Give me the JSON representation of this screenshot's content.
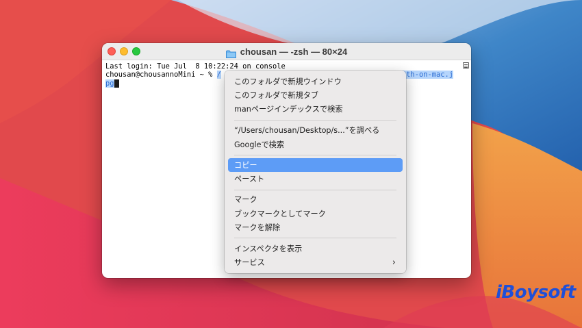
{
  "window": {
    "title": "chousan — -zsh — 80×24"
  },
  "terminal": {
    "line1": "Last login: Tue Jul  8 10:22:24 on console",
    "prompt": "chousan@chousannoMini ~ % ",
    "selected_head": "/",
    "selected_tail": "ath-on-mac.j",
    "line3_selected": "pg"
  },
  "menu": {
    "items": [
      {
        "label": "このフォルダで新規ウインドウ"
      },
      {
        "label": "このフォルダで新規タブ"
      },
      {
        "label": "manページインデックスで検索"
      },
      {
        "label": "“/Users/chousan/Desktop/s...”を調べる"
      },
      {
        "label": "Googleで検索"
      },
      {
        "label": "コピー",
        "active": true
      },
      {
        "label": "ペースト"
      },
      {
        "label": "マーク"
      },
      {
        "label": "ブックマークとしてマーク"
      },
      {
        "label": "マークを解除"
      },
      {
        "label": "インスペクタを表示"
      },
      {
        "label": "サービス",
        "submenu": true
      }
    ]
  },
  "brand": {
    "text": "iBoysoft"
  },
  "colors": {
    "highlight": "#5d9cf6",
    "selection": "#b5d5fc",
    "brand": "#1f4fd8"
  }
}
